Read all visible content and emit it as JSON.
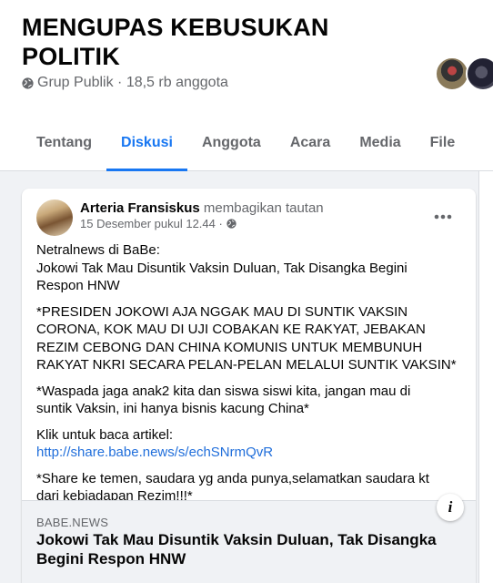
{
  "group": {
    "title_line1": "MENGUPAS KEBUSUKAN",
    "title_line2": "POLITIK",
    "meta": "Grup Publik · 18,5 rb anggota",
    "globe_icon": "globe-icon"
  },
  "tabs": [
    {
      "label": "Tentang",
      "active": false
    },
    {
      "label": "Diskusi",
      "active": true
    },
    {
      "label": "Anggota",
      "active": false
    },
    {
      "label": "Acara",
      "active": false
    },
    {
      "label": "Media",
      "active": false
    },
    {
      "label": "File",
      "active": false
    }
  ],
  "post": {
    "author": "Arteria Fransiskus",
    "action": "membagikan tautan",
    "time": "15 Desember pukul 12.44 ·",
    "more_icon": "more-horizontal-icon",
    "body": {
      "p1": [
        "Netralnews di BaBe:",
        "Jokowi Tak Mau Disuntik Vaksin Duluan, Tak Disangka Begini",
        "Respon HNW"
      ],
      "p2": [
        "*PRESIDEN JOKOWI AJA NGGAK MAU DI SUNTIK VAKSIN",
        "CORONA, KOK MAU DI UJI COBAKAN KE RAKYAT, JEBAKAN",
        "REZIM CEBONG DAN CHINA KOMUNIS UNTUK MEMBUNUH",
        "RAKYAT NKRI SECARA PELAN-PELAN MELALUI SUNTIK VAKSIN*"
      ],
      "p3": [
        "*Waspada jaga anak2 kita dan siswa siswi kita, jangan mau di",
        "suntik Vaksin, ini hanya bisnis kacung China*"
      ],
      "p4_label": "Klik untuk baca artikel:",
      "p4_link": "http://share.babe.news/s/echSNrmQvR",
      "p5": [
        "*Share ke temen, saudara yg anda punya,selamatkan saudara kt",
        "dari kebiadapan Rezim!!!*"
      ]
    },
    "preview": {
      "domain": "BABE.NEWS",
      "title_line1": "Jokowi Tak Mau Disuntik Vaksin Duluan, Tak Disangka",
      "title_line2": "Begini Respon HNW",
      "info_label": "i"
    }
  },
  "colors": {
    "accent": "#1877f2",
    "link": "#216fdb",
    "secondary_text": "#65676b",
    "page_bg": "#f0f2f5"
  }
}
